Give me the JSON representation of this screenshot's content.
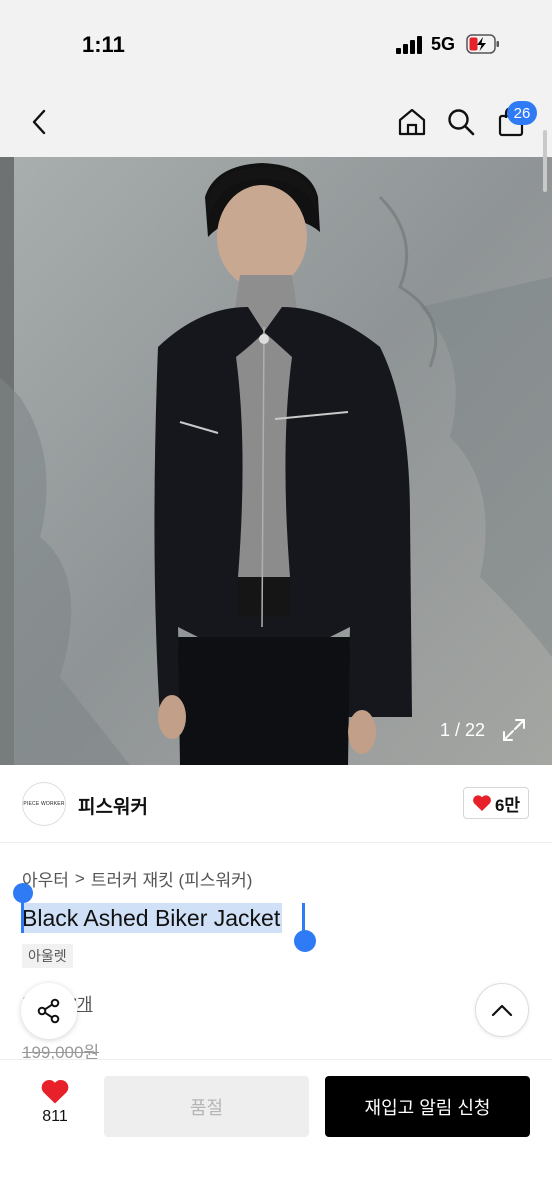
{
  "status_bar": {
    "time": "1:11",
    "network": "5G"
  },
  "nav": {
    "back_icon": "chevron-left-icon",
    "home_icon": "home-icon",
    "search_icon": "search-icon",
    "cart_icon": "shopping-bag-icon",
    "cart_count": "26"
  },
  "gallery": {
    "counter": "1 / 22",
    "expand_icon": "expand-icon"
  },
  "brand": {
    "logo_text": "PIECE WORKER",
    "name": "피스워커",
    "likes": "6만"
  },
  "product": {
    "breadcrumb": [
      "아우터",
      "트러커 재킷 (피스워커)"
    ],
    "title": "Black Ashed Biker Jacket",
    "tag": "아울렛",
    "reviews": "후기 57개",
    "original_price": "199,000원"
  },
  "bottom_bar": {
    "wish_count": "811",
    "soldout_label": "품절",
    "notify_label": "재입고 알림 신청"
  },
  "colors": {
    "accent": "#2f7bf5",
    "heart": "#e8202a",
    "primary_button": "#000000"
  }
}
